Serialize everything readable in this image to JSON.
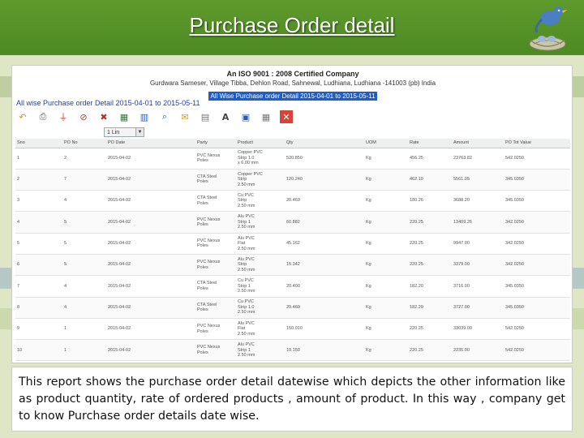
{
  "slide": {
    "title": "Purchase Order detail",
    "description": "This report shows the purchase order detail datewise which depicts the other information like as product quantity, rate of ordered products , amount of product. In this way , company get to know Purchase order details date wise."
  },
  "report": {
    "company_name": "An ISO 9001 : 2008 Certified Company",
    "company_address": "Gurdwara Sameser, Village Tibba, Dehlon Road, Sahnewal, Ludhiana, Ludhiana -141003 (pb) India",
    "highlighted_range": "All Wise Purchase order Detail 2015-04-01 to 2015-05-11",
    "title": "All wise Purchase order Detail 2015-04-01 to 2015-05-11",
    "page_selector": "1 Lin",
    "toolbar_icons": [
      "undo-icon",
      "print-icon",
      "filter-icon",
      "delete-filter-icon",
      "clear-icon",
      "export-icon",
      "chart-icon",
      "search-icon",
      "email-icon",
      "grid-icon",
      "font-icon",
      "layout-icon",
      "grid-settings-icon",
      "close-icon"
    ],
    "columns": [
      "Sno",
      "PO No",
      "PO Date",
      "Party",
      "Product",
      "Qty",
      "UOM",
      "Rate",
      "Amount",
      "PO Tot Value"
    ],
    "rows": [
      [
        "1",
        "2",
        "2015-04-02",
        "PVC Nexus\nPoles",
        "Copper PVC\nStrip 1.0\nx 6.00 mm",
        "520.850",
        "Kg",
        "456.25",
        "23763.82",
        "542.0250"
      ],
      [
        "2",
        "7",
        "2015-04-02",
        "CTA Steel\nPoles",
        "Copper PVC\nStrip\n2.50 mm",
        "120.240",
        "Kg",
        "462.10",
        "5561.05",
        "345.0350"
      ],
      [
        "3",
        "4",
        "2015-04-02",
        "CTA Steel\nPoles",
        "Cu PVC\nStrip\n2.50 mm",
        "20.460",
        "Kg",
        "180.26",
        "3688.20",
        "345.0350"
      ],
      [
        "4",
        "5",
        "2015-04-02",
        "PVC Nexus\nPoles",
        "Alu PVC\nStrip 1\n2.50 mm",
        "60.882",
        "Kg",
        "220.25",
        "13409.26",
        "342.0250"
      ],
      [
        "5",
        "5",
        "2015-04-02",
        "PVC Nexus\nPoles",
        "Alu PVC\nFlat\n2.50 mm",
        "45.162",
        "Kg",
        "220.25",
        "9947.00",
        "342.0250"
      ],
      [
        "6",
        "5",
        "2015-04-02",
        "PVC Nexus\nPoles",
        "Alu PVC\nStrip\n2.50 mm",
        "15.342",
        "Kg",
        "220.25",
        "3379.00",
        "342.0250"
      ],
      [
        "7",
        "4",
        "2015-04-02",
        "CTA Steel\nPoles",
        "Cu PVC\nStrip 1\n2.50 mm",
        "20.400",
        "Kg",
        "182.20",
        "3716.00",
        "345.0350"
      ],
      [
        "8",
        "4",
        "2015-04-02",
        "CTA Steel\nPoles",
        "Cu PVC\nStrip 1.0\n2.50 mm",
        "20.460",
        "Kg",
        "182.20",
        "3727.00",
        "345.0350"
      ],
      [
        "9",
        "1",
        "2015-04-02",
        "PVC Nexus\nPoles",
        "Alu PVC\nFlat\n2.50 mm",
        "150.010",
        "Kg",
        "220.25",
        "33039.00",
        "542.0250"
      ],
      [
        "10",
        "1",
        "2015-04-02",
        "PVC Nexus\nPoles",
        "Alu PVC\nStrip 1\n2.50 mm",
        "10.150",
        "Kg",
        "220.25",
        "2235.00",
        "542.0250"
      ]
    ]
  },
  "colors": {
    "header_green": "#4c8a22",
    "highlight_blue": "#1f5dc9",
    "title_blue": "#1f3faa"
  }
}
